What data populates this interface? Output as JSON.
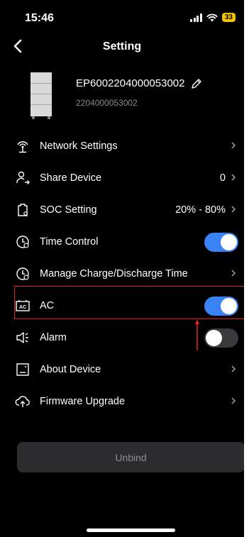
{
  "status_bar": {
    "time": "15:46",
    "battery": "33"
  },
  "nav": {
    "title": "Setting"
  },
  "device": {
    "name": "EP6002204000053002",
    "serial": "2204000053002"
  },
  "rows": [
    {
      "label": "Network Settings",
      "icon": "router-icon",
      "type": "chevron"
    },
    {
      "label": "Share Device",
      "icon": "share-user-icon",
      "type": "value",
      "value": "0"
    },
    {
      "label": "SOC Setting",
      "icon": "battery-settings-icon",
      "type": "value",
      "value": "20% - 80%"
    },
    {
      "label": "Time Control",
      "icon": "clock-settings-icon",
      "type": "toggle",
      "on": true
    },
    {
      "label": "Manage Charge/Discharge Time",
      "icon": "clock-settings-icon",
      "type": "chevron"
    },
    {
      "label": "AC",
      "icon": "ac-outlet-icon",
      "type": "toggle",
      "on": true
    },
    {
      "label": "Alarm",
      "icon": "speaker-icon",
      "type": "toggle",
      "on": false
    },
    {
      "label": "About Device",
      "icon": "device-info-icon",
      "type": "chevron"
    },
    {
      "label": "Firmware Upgrade",
      "icon": "cloud-upload-icon",
      "type": "chevron"
    }
  ],
  "unbind_label": "Unbind",
  "colors": {
    "accent": "#3b82f6",
    "highlight": "#dd2222",
    "background": "#000000"
  }
}
